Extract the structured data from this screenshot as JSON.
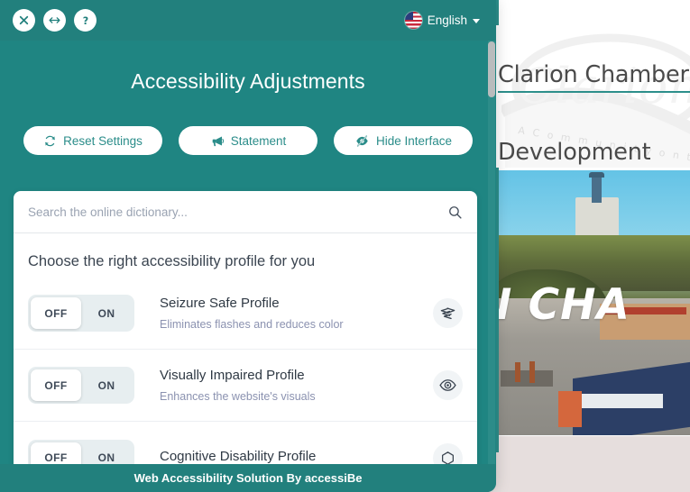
{
  "background_site": {
    "title_line1": "Clarion Chamber &",
    "title_line2": "Development",
    "watermark_tagline": "A Community on the Horizon",
    "hero_overlay_text": "ON CHA",
    "accent_color": "#2d8f8b",
    "page_background": "#e6dedd"
  },
  "panel": {
    "title": "Accessibility Adjustments",
    "header_color": "#22807d",
    "body_color": "#1f8582",
    "topbar": {
      "close_icon": "close-icon",
      "resize_icon": "resize-horizontal-icon",
      "help_icon": "question-mark-icon",
      "language": {
        "flag_icon": "us-flag-icon",
        "label": "English",
        "chevron_icon": "chevron-down-icon"
      }
    },
    "actions": [
      {
        "label": "Reset Settings",
        "icon": "refresh-icon"
      },
      {
        "label": "Statement",
        "icon": "megaphone-icon"
      },
      {
        "label": "Hide Interface",
        "icon": "eye-slash-icon"
      }
    ],
    "search": {
      "placeholder": "Search the online dictionary...",
      "value": "",
      "icon": "search-icon"
    },
    "profiles_heading": "Choose the right accessibility profile for you",
    "toggle_labels": {
      "off": "OFF",
      "on": "ON"
    },
    "profiles": [
      {
        "name": "Seizure Safe Profile",
        "description": "Eliminates flashes and reduces color",
        "state": "OFF",
        "icon": "waves-icon"
      },
      {
        "name": "Visually Impaired Profile",
        "description": "Enhances the website's visuals",
        "state": "OFF",
        "icon": "eye-icon"
      },
      {
        "name": "Cognitive Disability Profile",
        "description": "",
        "state": "OFF",
        "icon": "hexagon-icon"
      }
    ],
    "footer": "Web Accessibility Solution By accessiBe"
  }
}
